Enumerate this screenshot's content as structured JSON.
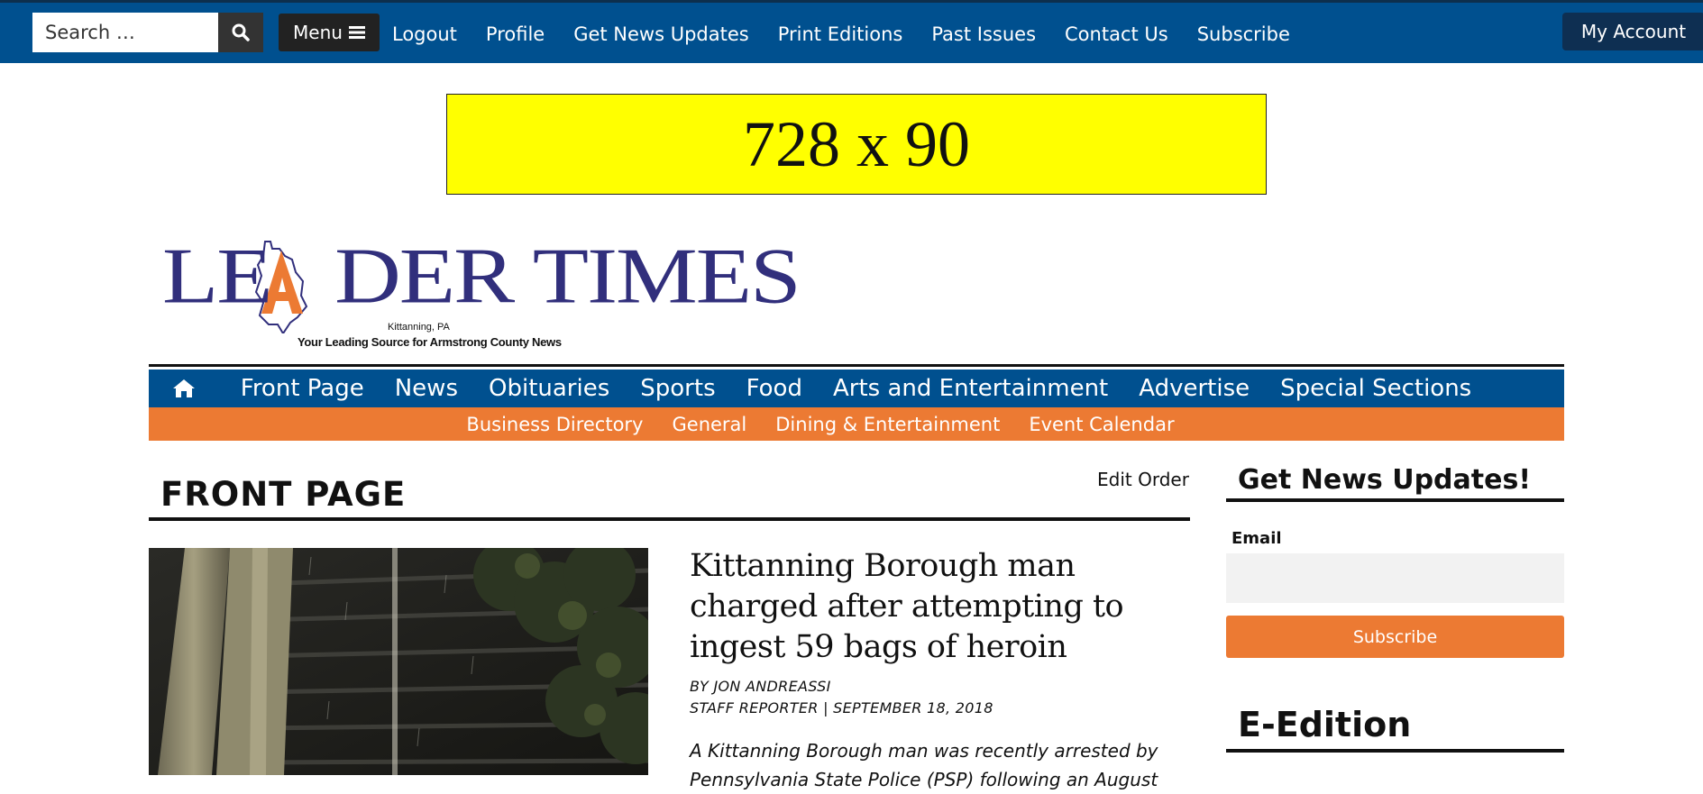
{
  "topbar": {
    "search_placeholder": "Search …",
    "menu_label": "Menu",
    "links": [
      "Logout",
      "Profile",
      "Get News Updates",
      "Print Editions",
      "Past Issues",
      "Contact Us",
      "Subscribe"
    ],
    "account_label": "My Account"
  },
  "ad": {
    "text": "728 x 90"
  },
  "logo": {
    "name": "LEADER TIMES",
    "city": "Kittanning, PA",
    "tagline": "Your Leading Source for Armstrong County News"
  },
  "mainnav": {
    "items": [
      "Front Page",
      "News",
      "Obituaries",
      "Sports",
      "Food",
      "Arts and Entertainment",
      "Advertise",
      "Special Sections"
    ]
  },
  "subnav": {
    "items": [
      "Business Directory",
      "General",
      "Dining & Entertainment",
      "Event Calendar"
    ]
  },
  "front": {
    "title": "FRONT PAGE",
    "edit_order": "Edit Order",
    "story": {
      "headline": "Kittanning Borough man charged after attempting to ingest 59 bags of heroin",
      "byline": "BY JON ANDREASSI",
      "meta": "STAFF REPORTER | SEPTEMBER 18, 2018",
      "excerpt": "A Kittanning Borough man was recently arrested by Pennsylvania State Police (PSP) following an August"
    }
  },
  "sidebar": {
    "updates_heading": "Get News Updates!",
    "email_label": "Email",
    "subscribe_label": "Subscribe",
    "eedition_heading": "E-Edition"
  },
  "colors": {
    "nav_blue": "#00508f",
    "accent_orange": "#ec7a33",
    "ad_yellow": "#ffff00",
    "logo_navy": "#312f7c"
  },
  "icons": [
    "search-icon",
    "hamburger-icon",
    "home-icon"
  ]
}
